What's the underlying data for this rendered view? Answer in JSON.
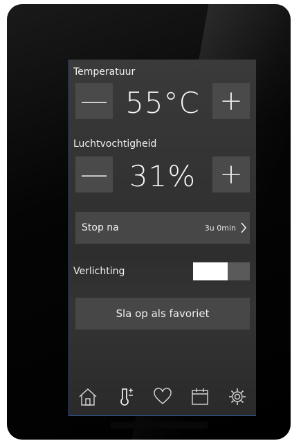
{
  "temperature": {
    "label": "Temperatuur",
    "value": "55°C",
    "minus": "—",
    "plus": "+"
  },
  "humidity": {
    "label": "Luchtvochtigheid",
    "value": "31%",
    "minus": "—",
    "plus": "+"
  },
  "stop": {
    "label": "Stop na",
    "value": "3u 0min"
  },
  "lighting": {
    "label": "Verlichting",
    "toggle_state": "on"
  },
  "favorite": {
    "label": "Sla op als favoriet"
  },
  "nav": {
    "items": [
      "home-icon",
      "thermometer-icon",
      "heart-icon",
      "calendar-icon",
      "settings-icon"
    ]
  },
  "colors": {
    "accent_border": "#2c5aa0",
    "panel": "#474747",
    "screen_bg": "#333333"
  }
}
